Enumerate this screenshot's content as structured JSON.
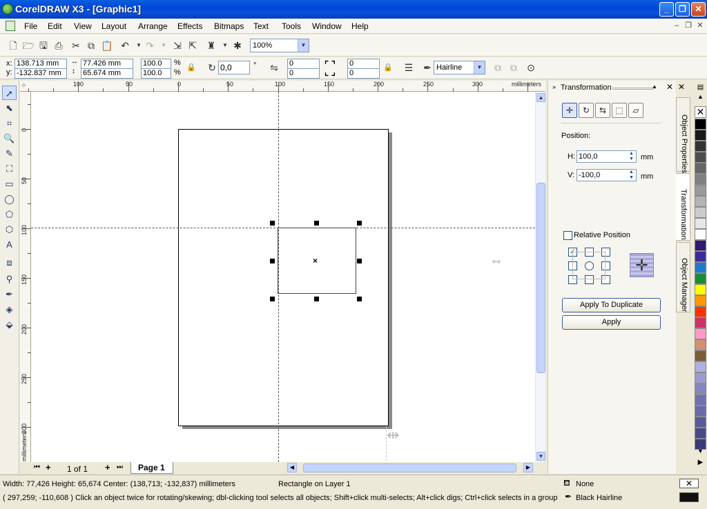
{
  "window": {
    "title": "CorelDRAW X3 - [Graphic1]",
    "buttons": {
      "minimize": "_",
      "maximize": "❐",
      "close": "✕"
    }
  },
  "menu": {
    "items": [
      "File",
      "Edit",
      "View",
      "Layout",
      "Arrange",
      "Effects",
      "Bitmaps",
      "Text",
      "Tools",
      "Window",
      "Help"
    ]
  },
  "toolbar": {
    "zoom": "100%"
  },
  "property_bar": {
    "x_label": "x:",
    "y_label": "y:",
    "x_value": "138.713 mm",
    "y_value": "-132.837 mm",
    "width_value": "77.426 mm",
    "height_value": "65.674 mm",
    "scale_x": "100.0",
    "scale_y": "100.0",
    "percent": "%",
    "rotation": "0,0",
    "degree": "°",
    "corner_tl": "0",
    "corner_bl": "0",
    "corner_tr": "0",
    "corner_br": "0",
    "outline": "Hairline"
  },
  "rulers": {
    "unit": "millimeters",
    "h_labels": [
      "100",
      "50",
      "0",
      "50",
      "100",
      "150",
      "200",
      "250",
      "300"
    ],
    "v_labels": [
      "0",
      "50",
      "100",
      "150",
      "200",
      "250",
      "300"
    ],
    "v_unit": "millimeters"
  },
  "page_nav": {
    "page_count": "1 of 1",
    "page_tab": "Page 1"
  },
  "docker": {
    "title": "Transformation",
    "position_label": "Position:",
    "h_label": "H:",
    "h_value": "100,0",
    "v_label": "V:",
    "v_value": "-100,0",
    "unit": "mm",
    "relative_label": "Relative Position",
    "relative_checked": false,
    "apply_duplicate": "Apply To Duplicate",
    "apply": "Apply",
    "side_tabs": [
      "Object Properties",
      "Transformation",
      "Object Manager"
    ]
  },
  "palette": {
    "colors": [
      "#000000",
      "#1a1a1a",
      "#333333",
      "#4d4d4d",
      "#666666",
      "#808080",
      "#999999",
      "#b3b3b3",
      "#cccccc",
      "#e6e6e6",
      "#ffffff",
      "#2e1a6e",
      "#3a2a9a",
      "#1f7ad0",
      "#1d8a3a",
      "#ffff00",
      "#ff9900",
      "#ff3300",
      "#cc3366",
      "#ff99cc",
      "#d29070",
      "#7a5c3a",
      "#b0b0e0",
      "#9a9ad0",
      "#8585c0",
      "#7070b0",
      "#6a6aa8",
      "#5a5a98",
      "#4a4a88",
      "#3a3a78"
    ]
  },
  "status": {
    "line1": "Width: 77,426  Height: 65,674  Center: (138,713; -132,837)  millimeters",
    "object_info": "Rectangle on Layer 1",
    "line2": "( 297,259; -110,608 )   Click an object twice for rotating/skewing; dbl-clicking tool selects all objects; Shift+click multi-selects; Alt+click digs; Ctrl+click selects in a group",
    "fill": "None",
    "outline": "Black  Hairline"
  }
}
